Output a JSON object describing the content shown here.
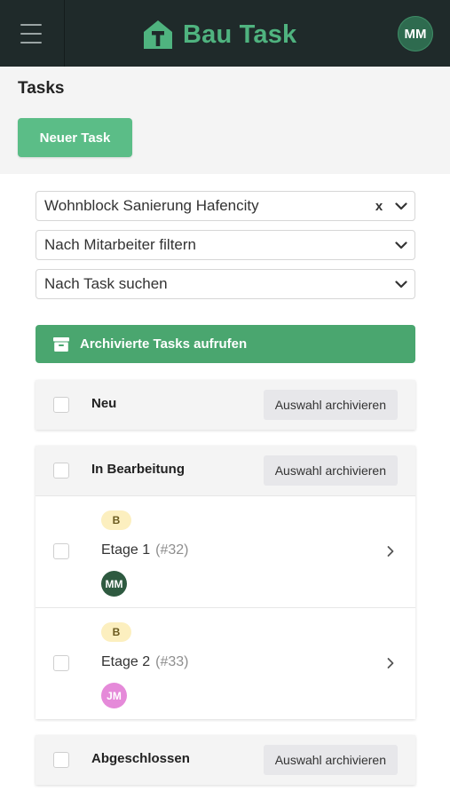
{
  "header": {
    "menu_icon": "hamburger-menu-icon",
    "app_name": "Bau Task",
    "logo_icon": "house-t-logo-icon",
    "user_initials": "MM",
    "brand_color": "#4fb37f",
    "bar_color": "#1f2a2a"
  },
  "page": {
    "title": "Tasks",
    "new_task_label": "Neuer Task"
  },
  "filters": {
    "project": {
      "value": "Wohnblock Sanierung Hafencity",
      "clear_label": "x"
    },
    "employee": {
      "placeholder": "Nach Mitarbeiter filtern"
    },
    "task": {
      "placeholder": "Nach Task suchen"
    }
  },
  "archive_button": {
    "label": "Archivierte Tasks aufrufen",
    "icon": "archive-box-icon"
  },
  "groups": [
    {
      "title": "Neu",
      "action_label": "Auswahl archivieren",
      "tasks": []
    },
    {
      "title": "In Bearbeitung",
      "action_label": "Auswahl archivieren",
      "tasks": [
        {
          "badge": "B",
          "name": "Etage 1",
          "id": "(#32)",
          "assignee": "MM",
          "assignee_color": "#2e5a40"
        },
        {
          "badge": "B",
          "name": "Etage 2",
          "id": "(#33)",
          "assignee": "JM",
          "assignee_color": "#e58ad9"
        }
      ]
    },
    {
      "title": "Abgeschlossen",
      "action_label": "Auswahl archivieren",
      "tasks": []
    }
  ]
}
